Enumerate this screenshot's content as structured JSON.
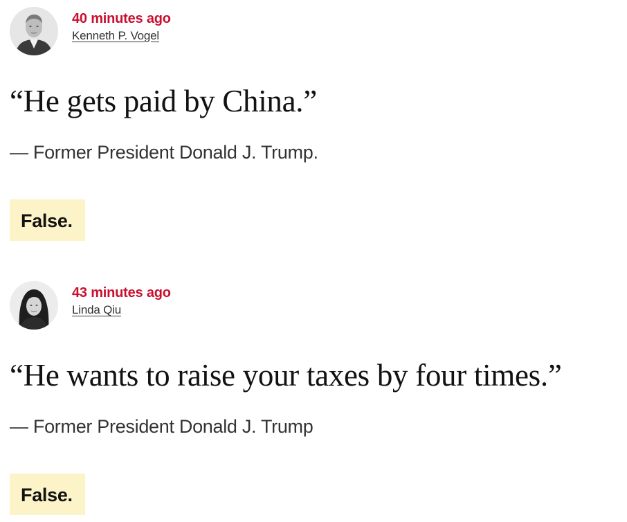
{
  "entries": [
    {
      "timestamp": "40 minutes ago",
      "author": "Kenneth P. Vogel",
      "quote": "“He gets paid by China.”",
      "attribution": "— Former President Donald J. Trump.",
      "verdict": "False."
    },
    {
      "timestamp": "43 minutes ago",
      "author": "Linda Qiu",
      "quote": "“He wants to raise your taxes by four times.”",
      "attribution": "— Former President Donald J. Trump",
      "verdict": "False."
    }
  ],
  "colors": {
    "timestamp": "#c8102e",
    "verdict_highlight": "#fdf3c8"
  },
  "icons": [
    "avatar-kenneth-vogel",
    "avatar-linda-qiu"
  ]
}
